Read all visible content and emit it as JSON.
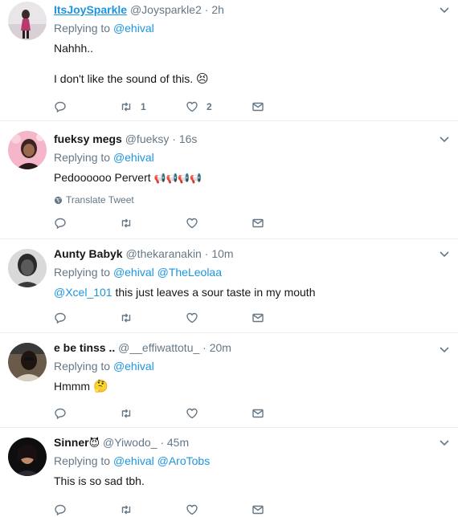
{
  "tweets": [
    {
      "name": "ItsJoySparkle",
      "handle": "@Joysparkle2",
      "dot": "·",
      "time": "2h",
      "replying_label": "Replying to",
      "mentions": [
        "@ehival"
      ],
      "text_lines": [
        "Nahhh..",
        "I don't like the sound of this."
      ],
      "emoji": "😣",
      "retweet_count": "1",
      "like_count": "2"
    },
    {
      "name": "fueksy megs",
      "handle": "@fueksy",
      "dot": "·",
      "time": "16s",
      "replying_label": "Replying to",
      "mentions": [
        "@ehival"
      ],
      "text": "Pedoooooo Pervert",
      "emoji": "📢📢📢📢",
      "translate_label": "Translate Tweet"
    },
    {
      "name": "Aunty Babyk",
      "handle": "@thekaranakin",
      "dot": "·",
      "time": "10m",
      "replying_label": "Replying to",
      "mentions": [
        "@ehival",
        "@TheLeolaa"
      ],
      "text_mention": "@Xcel_101",
      "text": " this just leaves a sour taste in my mouth"
    },
    {
      "name": "e be tinss ..",
      "handle": "@__effiwattotu_",
      "dot": "·",
      "time": "20m",
      "replying_label": "Replying to",
      "mentions": [
        "@ehival"
      ],
      "text": "Hmmm",
      "emoji": "🤔"
    },
    {
      "name": "Sinner",
      "name_emoji": "😈",
      "handle": "@Yiwodo_",
      "dot": "·",
      "time": "45m",
      "replying_label": "Replying to",
      "mentions": [
        "@ehival",
        "@AroTobs"
      ],
      "text": "This is so sad tbh."
    }
  ],
  "icons": {
    "reply": "reply-icon",
    "retweet": "retweet-icon",
    "like": "heart-icon",
    "dm": "envelope-icon",
    "more": "chevron-down-icon",
    "globe": "globe-icon"
  },
  "colors": {
    "link": "#1b95e0",
    "muted": "#657786",
    "text": "#14171a",
    "divider": "#e6ecf0"
  }
}
